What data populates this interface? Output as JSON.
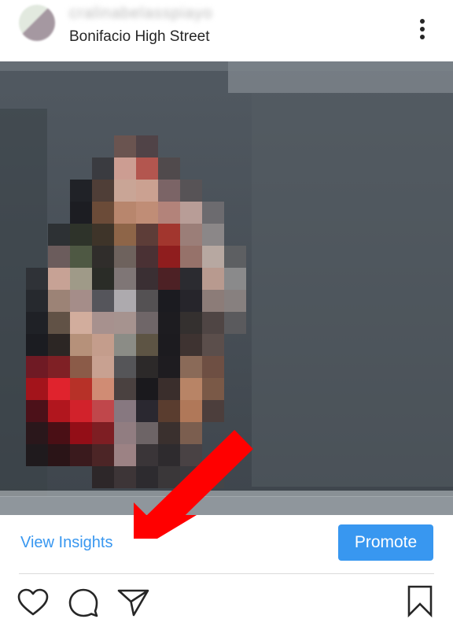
{
  "post_header": {
    "username": "cralinabelasspiayo",
    "location": "Bonifacio High Street"
  },
  "post_photo": {
    "blurred": true,
    "overlay": "red-arrow-pointing-to-view-insights"
  },
  "insights": {
    "view_insights_label": "View Insights",
    "promote_label": "Promote"
  },
  "actions": {
    "like_icon": "heart-icon",
    "comment_icon": "comment-icon",
    "share_icon": "paper-plane-icon",
    "save_icon": "bookmark-icon"
  },
  "colors": {
    "link_blue": "#3897f0",
    "promote_bg": "#3897f0",
    "annotation_red": "#ff0000"
  }
}
